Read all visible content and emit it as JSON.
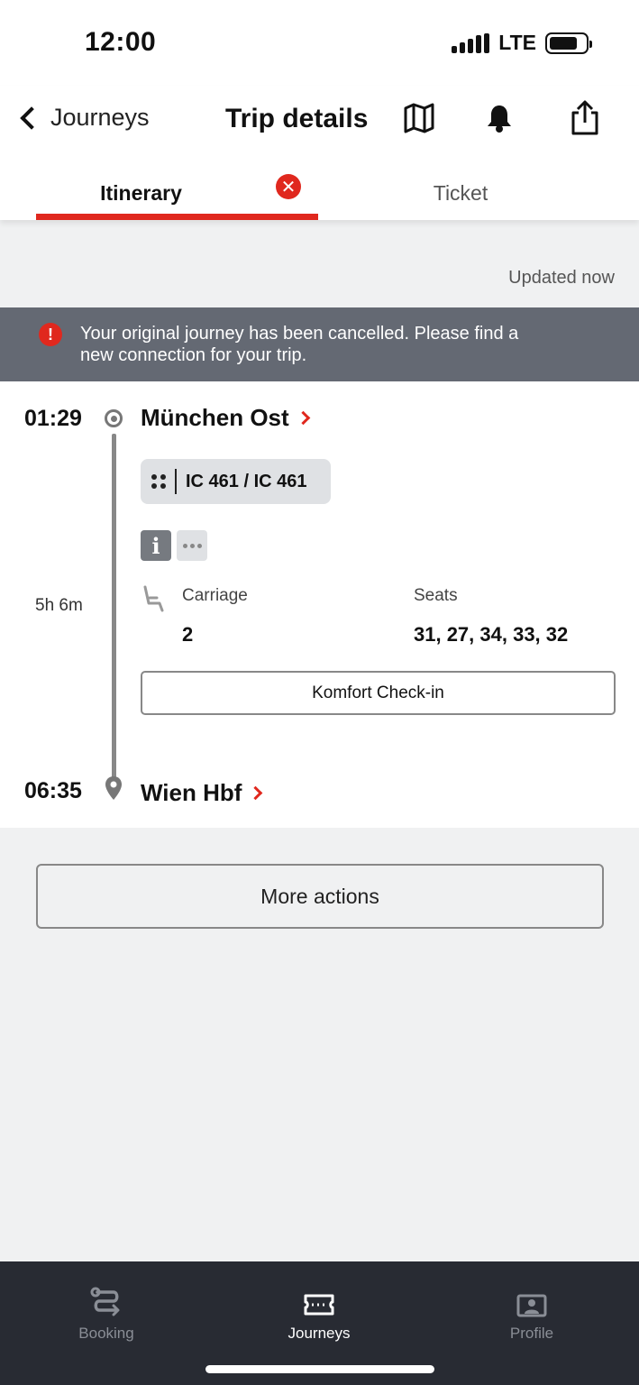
{
  "status_bar": {
    "time": "12:00",
    "network": "LTE"
  },
  "header": {
    "back_label": "Journeys",
    "title": "Trip details"
  },
  "tabs": [
    {
      "label": "Itinerary",
      "active": true
    },
    {
      "label": "Ticket",
      "active": false
    }
  ],
  "updated": "Updated now",
  "alert": {
    "message": "Your original journey has been cancelled. Please find a new connection for your trip."
  },
  "journey": {
    "departure_time": "01:29",
    "origin": "München Ost",
    "train": "IC 461 / IC 461",
    "duration": "5h 6m",
    "carriage_label": "Carriage",
    "carriage_value": "2",
    "seats_label": "Seats",
    "seats_value": "31, 27, 34, 33, 32",
    "checkin_label": "Komfort Check-in",
    "arrival_time": "06:35",
    "destination": "Wien Hbf"
  },
  "more_actions_label": "More actions",
  "tabbar": [
    {
      "label": "Booking",
      "icon": "route-icon",
      "active": false
    },
    {
      "label": "Journeys",
      "icon": "ticket-icon",
      "active": true
    },
    {
      "label": "Profile",
      "icon": "profile-card-icon",
      "active": false
    }
  ],
  "colors": {
    "accent": "#e0281e",
    "alert_bg": "#646973",
    "tabbar_bg": "#282b33"
  }
}
